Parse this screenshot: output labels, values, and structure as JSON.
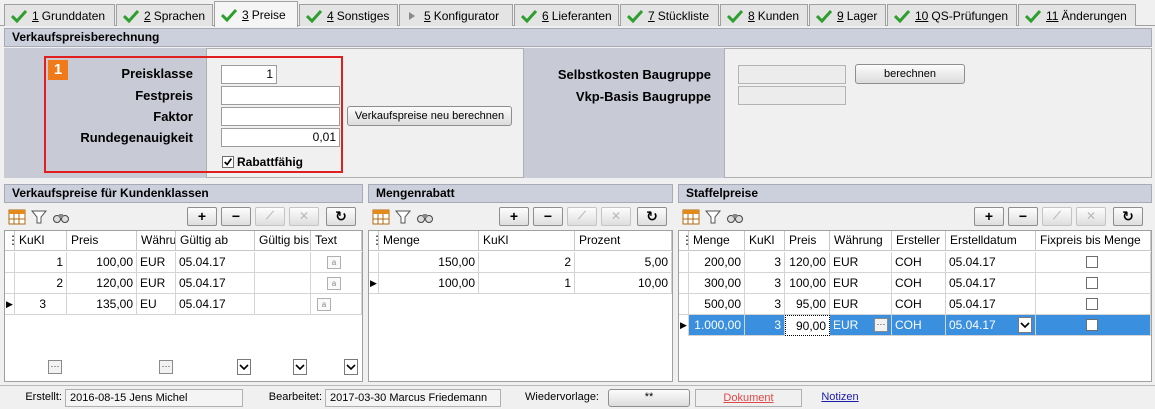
{
  "tabs": [
    {
      "num": "1",
      "label": "Grunddaten",
      "check": true
    },
    {
      "num": "2",
      "label": "Sprachen",
      "check": true
    },
    {
      "num": "3",
      "label": "Preise",
      "check": true,
      "active": true
    },
    {
      "num": "4",
      "label": "Sonstiges",
      "check": true
    },
    {
      "num": "5",
      "label": "Konfigurator",
      "check": false
    },
    {
      "num": "6",
      "label": "Lieferanten",
      "check": true
    },
    {
      "num": "7",
      "label": "Stückliste",
      "check": true
    },
    {
      "num": "8",
      "label": "Kunden",
      "check": true
    },
    {
      "num": "9",
      "label": "Lager",
      "check": true
    },
    {
      "num": "10",
      "label": "QS-Prüfungen",
      "check": true
    },
    {
      "num": "11",
      "label": "Änderungen",
      "check": true
    }
  ],
  "vkp": {
    "title": "Verkaufspreisberechnung",
    "badge": "1",
    "preisklasse_label": "Preisklasse",
    "preisklasse_value": "1",
    "festpreis_label": "Festpreis",
    "festpreis_value": "",
    "faktor_label": "Faktor",
    "faktor_value": "",
    "rundegenauigkeit_label": "Rundegenauigkeit",
    "rundegenauigkeit_value": "0,01",
    "rabattfaehig_label": "Rabattfähig",
    "rabattfaehig_checked": true,
    "recalc_button": "Verkaufspreise neu berechnen",
    "selbstkosten_label": "Selbstkosten Baugruppe",
    "selbstkosten_value": "",
    "vkpbasis_label": "Vkp-Basis Baugruppe",
    "vkpbasis_value": "",
    "berechnen_button": "berechnen"
  },
  "kundenklassen": {
    "title": "Verkaufspreise für Kundenklassen",
    "headers": [
      "KuKl",
      "Preis",
      "Währu",
      "Gültig ab",
      "Gültig bis",
      "Text"
    ],
    "rows": [
      {
        "kukl": "1",
        "preis": "100,00",
        "waehrung": "EUR",
        "gueltig_ab": "05.04.17",
        "gueltig_bis": ""
      },
      {
        "kukl": "2",
        "preis": "120,00",
        "waehrung": "EUR",
        "gueltig_ab": "05.04.17",
        "gueltig_bis": ""
      },
      {
        "kukl": "3",
        "preis": "135,00",
        "waehrung": "EU",
        "gueltig_ab": "05.04.17",
        "gueltig_bis": ""
      }
    ]
  },
  "mengenrabatt": {
    "title": "Mengenrabatt",
    "headers": [
      "Menge",
      "KuKl",
      "Prozent"
    ],
    "rows": [
      {
        "menge": "150,00",
        "kukl": "2",
        "prozent": "5,00"
      },
      {
        "menge": "100,00",
        "kukl": "1",
        "prozent": "10,00"
      }
    ]
  },
  "staffelpreise": {
    "title": "Staffelpreise",
    "headers": [
      "Menge",
      "KuKl",
      "Preis",
      "Währung",
      "Ersteller",
      "Erstelldatum",
      "Fixpreis bis Menge"
    ],
    "rows": [
      {
        "menge": "200,00",
        "kukl": "3",
        "preis": "120,00",
        "waehrung": "EUR",
        "ersteller": "COH",
        "datum": "05.04.17"
      },
      {
        "menge": "300,00",
        "kukl": "3",
        "preis": "100,00",
        "waehrung": "EUR",
        "ersteller": "COH",
        "datum": "05.04.17"
      },
      {
        "menge": "500,00",
        "kukl": "3",
        "preis": "95,00",
        "waehrung": "EUR",
        "ersteller": "COH",
        "datum": "05.04.17"
      },
      {
        "menge": "1.000,00",
        "kukl": "3",
        "preis": "90,00",
        "waehrung": "EUR",
        "ersteller": "COH",
        "datum": "05.04.17"
      }
    ]
  },
  "status": {
    "erstellt_label": "Erstellt:",
    "erstellt_value": "2016-08-15  Jens Michel",
    "bearbeitet_label": "Bearbeitet:",
    "bearbeitet_value": "2017-03-30  Marcus Friedemann",
    "wiedervorlage_label": "Wiedervorlage:",
    "wiedervorlage_value": "**",
    "dokument_link": "Dokument",
    "notizen_link": "Notizen"
  },
  "colors": {
    "selection": "#3b8fdf",
    "badge": "#f07a1a",
    "frame": "#e02020",
    "panel": "#c8cad6",
    "check": "#2e9e2e"
  }
}
